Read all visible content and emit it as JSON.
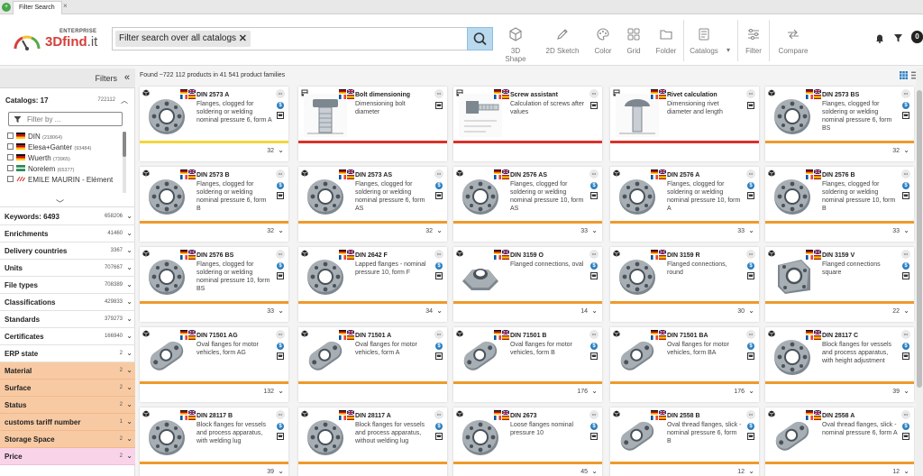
{
  "tab": {
    "label": "Filter Search"
  },
  "logo": {
    "enterprise": "ENTERPRISE",
    "name_main": "3Dfind",
    "name_suffix": ".it"
  },
  "search": {
    "chip_text": "Filter search over all catalogs"
  },
  "toolbar": [
    {
      "id": "3d-shape",
      "label": "3D Shape",
      "icon": "cube-icon"
    },
    {
      "id": "2d-sketch",
      "label": "2D Sketch",
      "icon": "pencil-icon"
    },
    {
      "id": "color",
      "label": "Color",
      "icon": "palette-icon"
    },
    {
      "id": "grid",
      "label": "Grid",
      "icon": "grid-icon"
    },
    {
      "id": "folder",
      "label": "Folder",
      "icon": "folder-icon"
    },
    {
      "id": "catalogs",
      "label": "Catalogs",
      "icon": "catalog-icon"
    },
    {
      "id": "filter",
      "label": "Filter",
      "icon": "sliders-icon"
    },
    {
      "id": "compare",
      "label": "Compare",
      "icon": "compare-icon"
    }
  ],
  "sidebar": {
    "title": "Filters",
    "catalogs": {
      "label": "Catalogs: 17",
      "count": "722112",
      "filter_placeholder": "Filter by ...",
      "items": [
        {
          "name": "DIN",
          "count": "(218064)",
          "flag": "de"
        },
        {
          "name": "Elesa+Ganter",
          "count": "(93484)",
          "flag": "de"
        },
        {
          "name": "Wuerth",
          "count": "(73965)",
          "flag": "de"
        },
        {
          "name": "Norelem",
          "count": "(65377)",
          "flag": "norelem"
        },
        {
          "name": "EMILE MAURIN - Elément",
          "count": "",
          "flag": "maurin"
        }
      ]
    },
    "filters": [
      {
        "label": "Keywords: 6493",
        "count": "658206",
        "style": "plain"
      },
      {
        "label": "Enrichments",
        "count": "41460",
        "style": "plain"
      },
      {
        "label": "Delivery countries",
        "count": "3367",
        "style": "plain"
      },
      {
        "label": "Units",
        "count": "707667",
        "style": "plain"
      },
      {
        "label": "File types",
        "count": "708389",
        "style": "plain"
      },
      {
        "label": "Classifications",
        "count": "429833",
        "style": "plain"
      },
      {
        "label": "Standards",
        "count": "379273",
        "style": "plain"
      },
      {
        "label": "Certificates",
        "count": "166940",
        "style": "plain"
      },
      {
        "label": "ERP state",
        "count": "2",
        "style": "plain"
      },
      {
        "label": "Material",
        "count": "2",
        "style": "orange"
      },
      {
        "label": "Surface",
        "count": "2",
        "style": "orange"
      },
      {
        "label": "Status",
        "count": "2",
        "style": "orange"
      },
      {
        "label": "customs tariff number",
        "count": "1",
        "style": "orange"
      },
      {
        "label": "Storage Space",
        "count": "2",
        "style": "orange"
      },
      {
        "label": "Price",
        "count": "2",
        "style": "pink"
      }
    ]
  },
  "results": {
    "found_text": "Found ~722 112 products in 41 541 product families",
    "cards": [
      {
        "title": "DIN 2573 A",
        "desc": "Flanges, clogged for soldering or welding nominal pressure 6, form A",
        "count": "32",
        "bar": "#f3d53c",
        "kind": "flange",
        "calc": false
      },
      {
        "title": "Bolt dimensioning",
        "desc": "Dimensioning bolt diameter",
        "count": "",
        "bar": "#d9322b",
        "kind": "bolt",
        "calc": true
      },
      {
        "title": "Screw assistant",
        "desc": "Calculation of screws after values",
        "count": "",
        "bar": "#d9322b",
        "kind": "screw",
        "calc": true
      },
      {
        "title": "Rivet calculation",
        "desc": "Dimensioning rivet diameter and length",
        "count": "",
        "bar": "#d9322b",
        "kind": "rivet",
        "calc": true
      },
      {
        "title": "DIN 2573 BS",
        "desc": "Flanges, clogged for soldering or welding nominal pressure 6, form BS",
        "count": "32",
        "bar": "#ee9a2c",
        "kind": "flange",
        "calc": false
      },
      {
        "title": "DIN 2573 B",
        "desc": "Flanges, clogged for soldering or welding nominal pressure 6, form B",
        "count": "32",
        "bar": "#ee9a2c",
        "kind": "flange",
        "calc": false
      },
      {
        "title": "DIN 2573 AS",
        "desc": "Flanges, clogged for soldering or welding nominal pressure 6, form AS",
        "count": "32",
        "bar": "#ee9a2c",
        "kind": "flange",
        "calc": false
      },
      {
        "title": "DIN 2576 AS",
        "desc": "Flanges, clogged for soldering or welding nominal pressure 10, form AS",
        "count": "33",
        "bar": "#ee9a2c",
        "kind": "flange",
        "calc": false
      },
      {
        "title": "DIN 2576 A",
        "desc": "Flanges, clogged for soldering or welding nominal pressure 10, form A",
        "count": "33",
        "bar": "#ee9a2c",
        "kind": "flange",
        "calc": false
      },
      {
        "title": "DIN 2576 B",
        "desc": "Flanges, clogged for soldering or welding nominal pressure 10, form B",
        "count": "33",
        "bar": "#ee9a2c",
        "kind": "flange",
        "calc": false
      },
      {
        "title": "DIN 2576 BS",
        "desc": "Flanges, clogged for soldering or welding nominal pressure 10, form BS",
        "count": "33",
        "bar": "#ee9a2c",
        "kind": "flange",
        "calc": false
      },
      {
        "title": "DIN 2642 F",
        "desc": "Lapped flanges - nominal pressure 10, form F",
        "count": "34",
        "bar": "#ee9a2c",
        "kind": "flange",
        "calc": false
      },
      {
        "title": "DIN 3159 O",
        "desc": "Flanged connections, oval",
        "count": "14",
        "bar": "#ee9a2c",
        "kind": "oval2",
        "calc": false
      },
      {
        "title": "DIN 3159 R",
        "desc": "Flanged connections, round",
        "count": "30",
        "bar": "#ee9a2c",
        "kind": "flange",
        "calc": false
      },
      {
        "title": "DIN 3159 V",
        "desc": "Flanged connections square",
        "count": "22",
        "bar": "#ee9a2c",
        "kind": "square",
        "calc": false
      },
      {
        "title": "DIN 71501 AG",
        "desc": "Oval flanges for motor vehicles, form AG",
        "count": "132",
        "bar": "#ee9a2c",
        "kind": "oval",
        "calc": false
      },
      {
        "title": "DIN 71501 A",
        "desc": "Oval flanges for motor vehicles, form A",
        "count": "",
        "bar": "#ee9a2c",
        "kind": "oval",
        "calc": false
      },
      {
        "title": "DIN 71501 B",
        "desc": "Oval flanges for motor vehicles, form B",
        "count": "176",
        "bar": "#ee9a2c",
        "kind": "oval",
        "calc": false
      },
      {
        "title": "DIN 71501 BA",
        "desc": "Oval flanges for motor vehicles, form BA",
        "count": "176",
        "bar": "#ee9a2c",
        "kind": "oval",
        "calc": false
      },
      {
        "title": "DIN 28117 C",
        "desc": "Block flanges for vessels and process apparatus, with height adjustment",
        "count": "39",
        "bar": "#ee9a2c",
        "kind": "flange",
        "calc": false
      },
      {
        "title": "DIN 28117 B",
        "desc": "Block flanges for vessels and process apparatus, with welding lug",
        "count": "39",
        "bar": "#ee9a2c",
        "kind": "flange",
        "calc": false
      },
      {
        "title": "DIN 28117 A",
        "desc": "Block flanges for vessels and process apparatus, without welding lug",
        "count": "",
        "bar": "#ee9a2c",
        "kind": "flange",
        "calc": false
      },
      {
        "title": "DIN 2673",
        "desc": "Loose flanges nominal pressure 10",
        "count": "45",
        "bar": "#ee9a2c",
        "kind": "flange",
        "calc": false
      },
      {
        "title": "DIN 2558 B",
        "desc": "Oval thread flanges, slick - nominal pressure 6, form B",
        "count": "12",
        "bar": "#ee9a2c",
        "kind": "oval",
        "calc": false
      },
      {
        "title": "DIN 2558 A",
        "desc": "Oval thread flanges, slick - nominal pressure 6, form A",
        "count": "12",
        "bar": "#ee9a2c",
        "kind": "oval",
        "calc": false
      }
    ]
  }
}
